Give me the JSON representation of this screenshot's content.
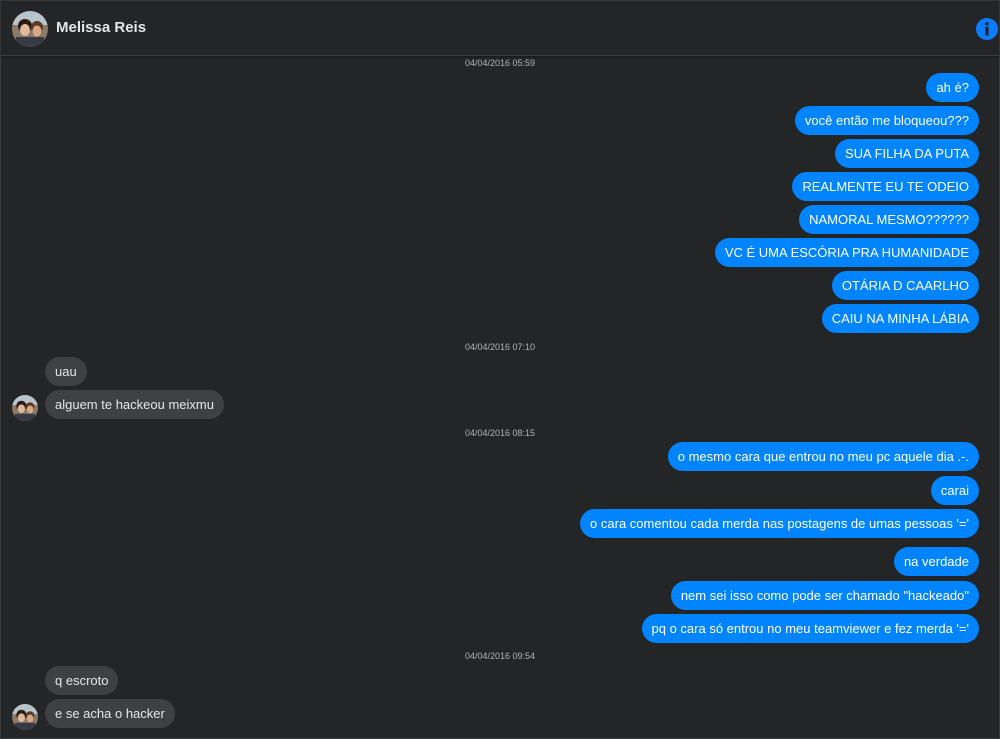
{
  "colors": {
    "background": "#242526",
    "outgoing_bubble": "#0084ff",
    "incoming_bubble": "#3e4042",
    "accent_info": "#0a7cff"
  },
  "header": {
    "contact_name": "Melissa Reis",
    "avatar_icon": "profile-photo",
    "info_icon": "info-icon"
  },
  "conversation": {
    "timestamps": [
      "04/04/2016 05:59",
      "04/04/2016 07:10",
      "04/04/2016 08:15",
      "04/04/2016 09:54"
    ],
    "group1_outgoing": [
      "ah é?",
      "você então me bloqueou???",
      "SUA FILHA DA PUTA",
      "REALMENTE EU TE ODEIO",
      "NAMORAL MESMO??????",
      "VC É UMA ESCÓRIA PRA HUMANIDADE",
      "OTÁRIA D CAARLHO",
      "CAIU NA MINHA LÁBIA"
    ],
    "group2_incoming": [
      "uau",
      "alguem te hackeou meixmu"
    ],
    "group3_outgoing": [
      "o mesmo cara que entrou no meu pc aquele dia .-.",
      "carai",
      "o cara comentou cada merda nas postagens de umas pessoas '='",
      "na verdade",
      "nem sei isso como pode ser chamado \"hackeado\"",
      "pq o cara só entrou no meu teamviewer e fez merda '='"
    ],
    "group4_incoming": [
      "q escroto",
      "e se acha o hacker"
    ]
  }
}
